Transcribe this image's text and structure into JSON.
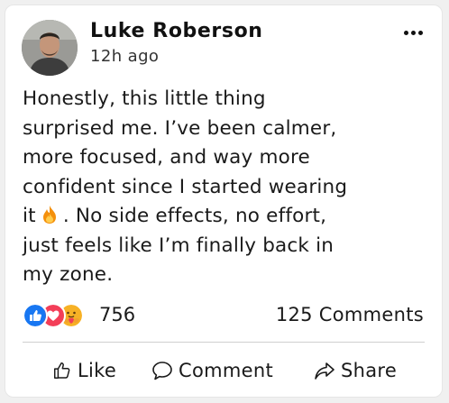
{
  "post": {
    "author": "Luke Roberson",
    "time": "12h ago",
    "text_lines": [
      "Honestly, this little thing",
      "surprised me. I’ve been calmer,",
      "more focused, and way more",
      "confident since I started wearing"
    ],
    "text_line5_start": "it",
    "text_line5_end": ". No side effects, no effort,",
    "text_line6": "just feels like I’m finally back in",
    "text_line7": "my zone.",
    "emoji": "fire-emoji"
  },
  "stats": {
    "reaction_icons": [
      "like-icon",
      "love-icon",
      "care-icon"
    ],
    "reaction_count": "756",
    "comments": "125 Comments"
  },
  "actions": {
    "like": "Like",
    "comment": "Comment",
    "share": "Share"
  },
  "colors": {
    "like_blue": "#1877f2",
    "love_red": "#f33e58",
    "care_yellow": "#f7b125"
  }
}
